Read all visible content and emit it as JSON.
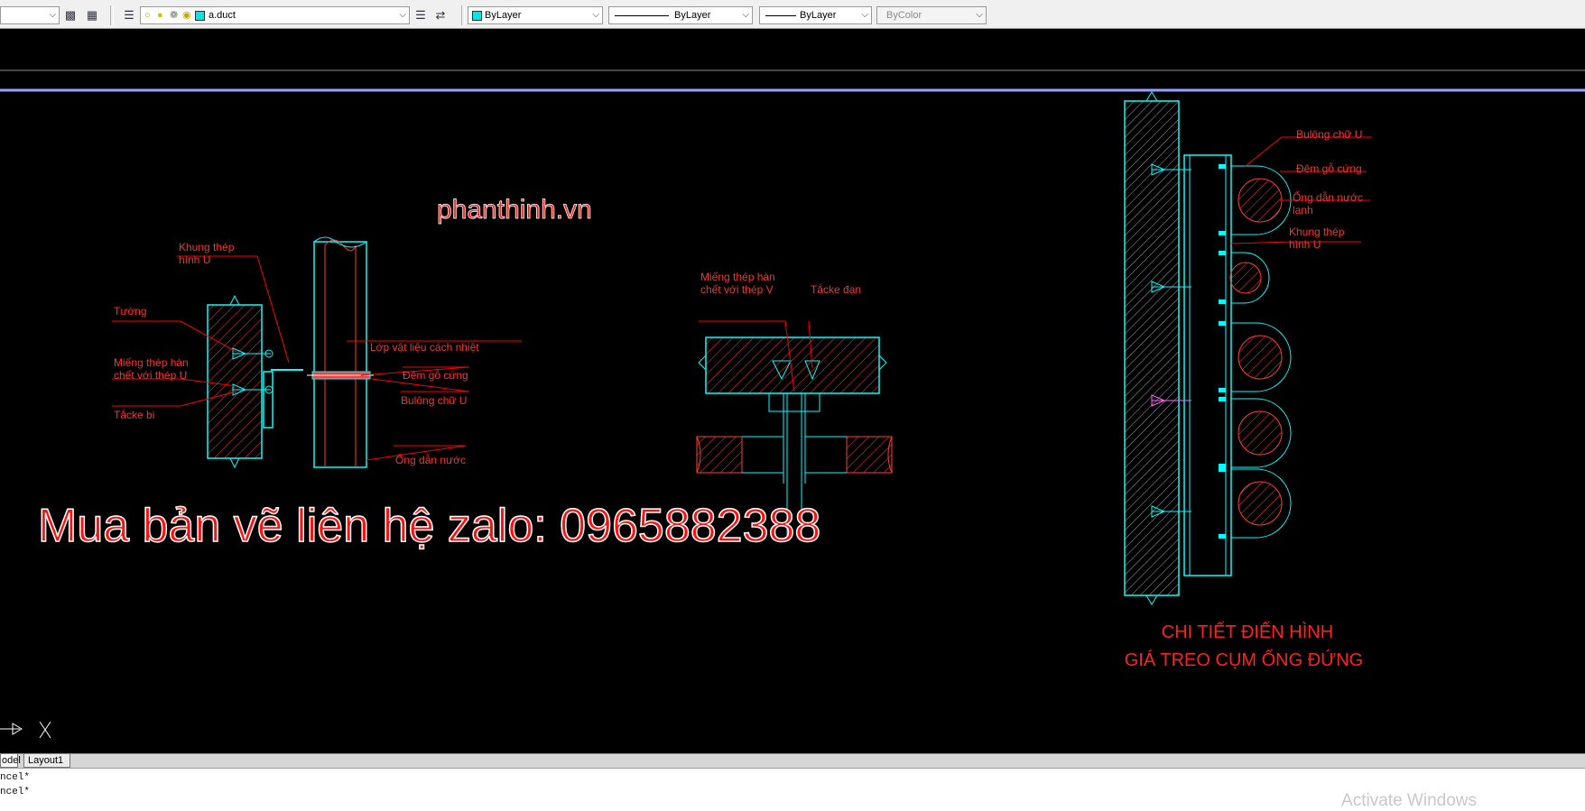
{
  "toolbar": {
    "layer_name": "a.duct",
    "color": "ByLayer",
    "linetype": "ByLayer",
    "lineweight": "ByLayer",
    "plotstyle": "ByColor"
  },
  "drawing": {
    "website_label": "phanthinh.vn",
    "promo_text": "Mua bản vẽ liên hệ zalo: 0965882388",
    "detail1": {
      "khung_thep_1": "Khung thép",
      "khung_thep_2": "hình U",
      "tuong": "Tường",
      "mieng_thep_1": "Miếng thép hàn",
      "mieng_thep_2": "chết với thép U",
      "tacke_bi": "Tắcke bi",
      "lop_vat_lieu": "Lớp vật liệu cách nhiệt",
      "dem_go": "Đệm gỗ cứng",
      "bulong": "Bulông chữ U",
      "ong_dan": "Ống dẫn nước"
    },
    "detail2": {
      "mieng_thep_1": "Miếng thép hàn",
      "mieng_thep_2": "chết với thép V",
      "tacke_dan": "Tắcke đạn"
    },
    "detail3": {
      "bulong": "Bulông chữ U",
      "dem_go": "Đệm gỗ cứng",
      "ong_dan_1": "Ống dẫn nước",
      "ong_dan_2": "lạnh",
      "khung_1": "Khung thép",
      "khung_2": "hình U"
    },
    "title_line1": "CHI TIẾT ĐIỂN HÌNH",
    "title_line2": "GIÁ TREO CỤM ỐNG ĐỨNG"
  },
  "tabs": [
    "odel",
    "Layout1"
  ],
  "command": {
    "line1": "ncel*",
    "line2": "ncel*"
  },
  "watermark": "Activate Windows",
  "colors": {
    "canvas_bg": "#000000",
    "cyan": "#00ffff",
    "red": "#ff0000",
    "magenta_label": "#ff6a6a",
    "highlight_line": "#9aa0ff"
  }
}
